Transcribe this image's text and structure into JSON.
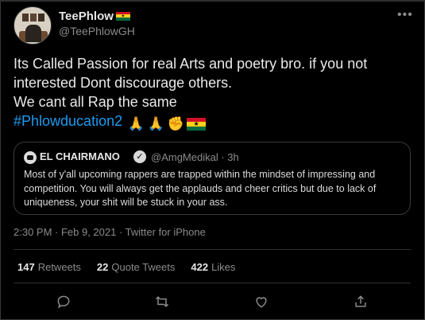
{
  "author": {
    "display_name": "TeePhlow",
    "handle": "@TeePhlowGH",
    "name_flag_icon": "ghana-flag-icon",
    "avatar_icon": "profile-photo"
  },
  "tweet": {
    "lines": [
      "Its Called Passion for real Arts and poetry bro. if you not",
      "interested Dont discourage others.",
      "We cant all Rap the same"
    ],
    "hashtag": "#Phlowducation2",
    "emojis": [
      "folded-hands-icon",
      "folded-hands-icon",
      "raised-fist-icon",
      "ghana-flag-icon"
    ]
  },
  "quoted_tweet": {
    "display_name": "EL CHAIRMANO",
    "handle_time": "@AmgMedikal · 3h",
    "lines": [
      "Most of y'all upcoming rappers are trapped within the mindset of impressing and",
      "competition. You will always get the applauds and cheer critics but due to lack of",
      "uniqueness, your shit will be stuck in your ass."
    ]
  },
  "meta": {
    "timestamp": "2:30 PM · Feb 9, 2021 · Twitter for iPhone"
  },
  "stats": {
    "retweets_count": "147",
    "retweets_label": "Retweets",
    "quotes_count": "22",
    "quotes_label": "Quote Tweets",
    "likes_count": "422",
    "likes_label": "Likes"
  },
  "actions": [
    "reply-icon",
    "retweet-icon",
    "like-icon",
    "share-icon"
  ],
  "colors": {
    "background": "#000000",
    "link": "#1d9bf0",
    "muted": "#8b8b8b",
    "border": "#3a3a3a"
  }
}
